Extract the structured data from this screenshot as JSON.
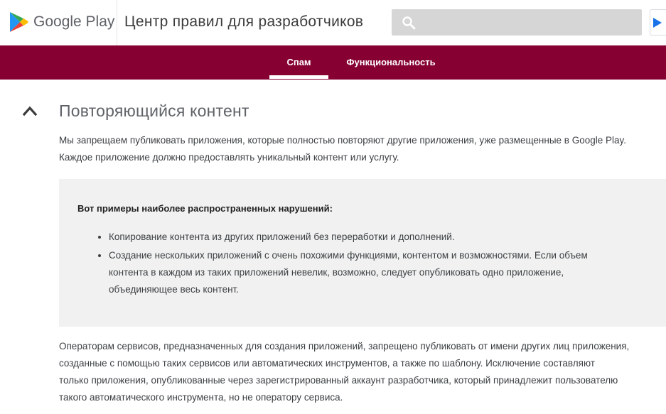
{
  "header": {
    "brand": "Google Play",
    "site_title": "Центр правил для разработчиков",
    "search_placeholder": ""
  },
  "colors": {
    "nav_background": "#870032",
    "search_background": "#d6d6d6",
    "example_background": "#f1f1f1"
  },
  "nav": {
    "tabs": [
      {
        "label": "Спам",
        "active": true
      },
      {
        "label": "Функциональность",
        "active": false
      }
    ]
  },
  "section": {
    "title": "Повторяющийся контент",
    "expanded": true,
    "intro_lines": [
      "Мы запрещаем публиковать приложения, которые полностью повторяют другие приложения, уже размещенные в Google Play.",
      "Каждое приложение должно предоставлять уникальный контент или услугу."
    ],
    "examples_title": "Вот примеры наиболее распространенных нарушений:",
    "examples": [
      {
        "lines": [
          "Копирование контента из других приложений без переработки и дополнений."
        ]
      },
      {
        "lines": [
          "Создание нескольких приложений с очень похожими функциями, контентом и возможностями. Если объем",
          "контента в каждом из таких приложений невелик, возможно, следует опубликовать одно приложение,",
          "объединяющее весь контент."
        ]
      }
    ],
    "paragraph_lines": [
      "Операторам сервисов, предназначенных для создания приложений, запрещено публиковать от имени других лиц приложения,",
      "созданные с помощью таких сервисов или автоматических инструментов, а также по шаблону. Исключение составляют",
      "только приложения, опубликованные через зарегистрированный аккаунт разработчика, который принадлежит пользователю",
      "такого автоматического инструмента, но не оператору сервиса."
    ]
  },
  "icons": {
    "logo": "google-play-logo-icon",
    "search": "search-icon",
    "collapse": "chevron-up-icon",
    "corner": "play-triangle-icon"
  }
}
